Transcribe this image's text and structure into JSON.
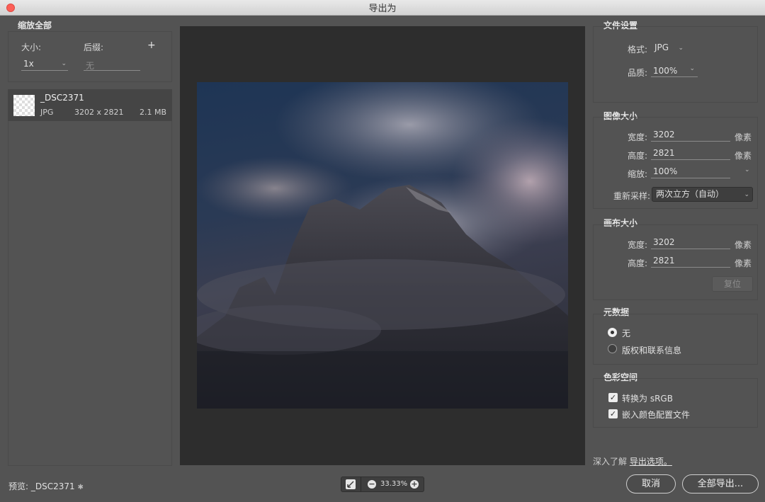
{
  "window": {
    "title": "导出为"
  },
  "left": {
    "header": "缩放全部",
    "size_label": "大小:",
    "suffix_label": "后缀:",
    "size_value": "1x",
    "suffix_placeholder": "无",
    "asset": {
      "name": "_DSC2371",
      "format": "JPG",
      "dimensions": "3202 x 2821",
      "filesize": "2.1 MB"
    }
  },
  "file_settings": {
    "title": "文件设置",
    "format_label": "格式:",
    "format_value": "JPG",
    "quality_label": "品质:",
    "quality_value": "100%"
  },
  "image_size": {
    "title": "图像大小",
    "width_label": "宽度:",
    "width_value": "3202",
    "height_label": "高度:",
    "height_value": "2821",
    "scale_label": "缩放:",
    "scale_value": "100%",
    "resample_label": "重新采样:",
    "resample_value": "两次立方（自动）",
    "unit": "像素"
  },
  "canvas_size": {
    "title": "画布大小",
    "width_label": "宽度:",
    "width_value": "3202",
    "height_label": "高度:",
    "height_value": "2821",
    "unit": "像素",
    "reset_label": "复位"
  },
  "metadata": {
    "title": "元数据",
    "options": [
      "无",
      "版权和联系信息"
    ],
    "selected_index": 0
  },
  "color_space": {
    "title": "色彩空间",
    "convert_label": "转换为 sRGB",
    "embed_label": "嵌入颜色配置文件"
  },
  "learn_more": {
    "prefix": "深入了解",
    "link": "导出选项。"
  },
  "bottom": {
    "preview_label": "预览:",
    "preview_name": "_DSC2371",
    "zoom": "33.33%",
    "cancel_label": "取消",
    "export_all_label": "全部导出..."
  }
}
